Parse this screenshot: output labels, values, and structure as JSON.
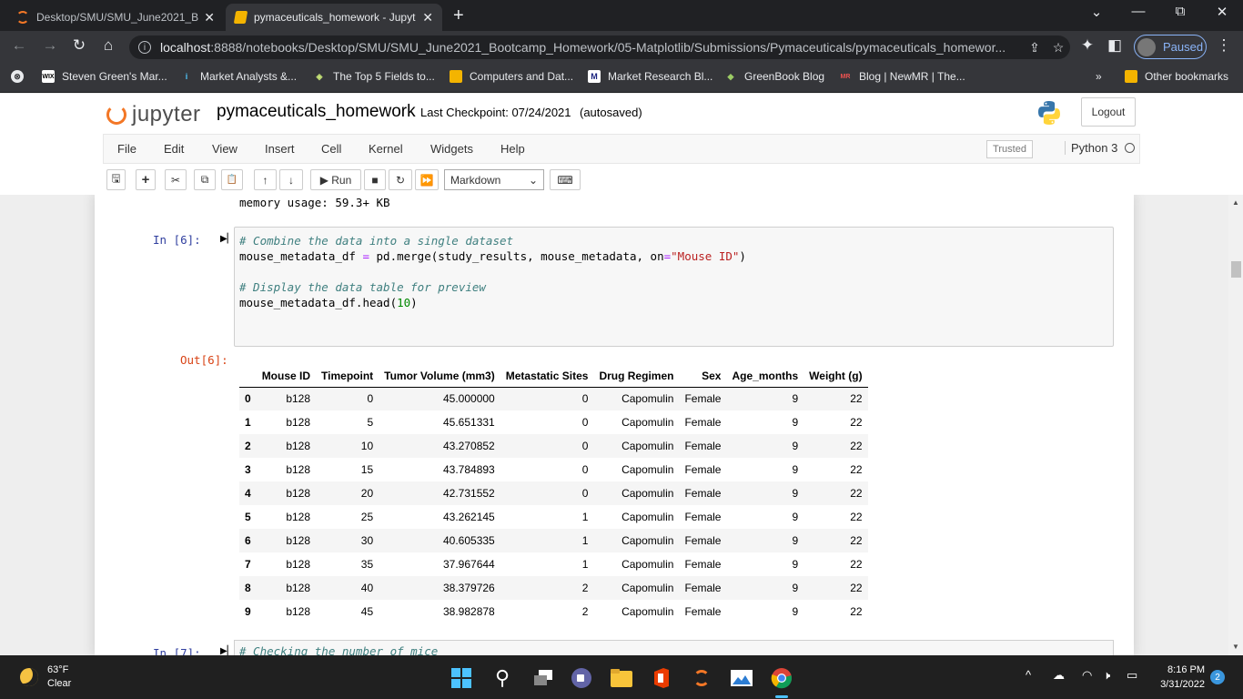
{
  "browser": {
    "tabs": [
      {
        "title": "Desktop/SMU/SMU_June2021_Bo",
        "close": "✕",
        "icon": "jupyter-icon"
      },
      {
        "title": "pymaceuticals_homework - Jupyt",
        "close": "✕",
        "icon": "notebook-icon"
      }
    ],
    "new_tab": "+",
    "window_controls": {
      "dropdown": "⌄",
      "minimize": "—",
      "maximize": "⧉",
      "close": "✕"
    },
    "nav": {
      "back": "←",
      "forward": "→",
      "reload": "↻",
      "home": "⌂"
    },
    "address": {
      "host": "localhost",
      "path": ":8888/notebooks/Desktop/SMU/SMU_June2021_Bootcamp_Homework/05-Matplotlib/Submissions/Pymaceuticals/pymaceuticals_homewor..."
    },
    "profile_label": "Paused",
    "menu_dots": "⋮",
    "bookmarks": [
      {
        "label": "Steven Green's Mar...",
        "icon": "WIX"
      },
      {
        "label": "Market Analysts &...",
        "icon": "i"
      },
      {
        "label": "The Top 5 Fields to...",
        "icon": "◈"
      },
      {
        "label": "Computers and Dat...",
        "icon": ""
      },
      {
        "label": "Market Research Bl...",
        "icon": "M"
      },
      {
        "label": "GreenBook Blog",
        "icon": "◆"
      },
      {
        "label": "Blog | NewMR | The...",
        "icon": "MR"
      }
    ],
    "bookmarks_more": "»",
    "other_bookmarks": "Other bookmarks"
  },
  "jupyter": {
    "logo_text": "jupyter",
    "notebook_name": "pymaceuticals_homework",
    "checkpoint": "Last Checkpoint: 07/24/2021",
    "autosave": "(autosaved)",
    "logout": "Logout",
    "menus": [
      "File",
      "Edit",
      "View",
      "Insert",
      "Cell",
      "Kernel",
      "Widgets",
      "Help"
    ],
    "trusted": "Trusted",
    "kernel": "Python 3",
    "toolbar": {
      "save": "🖫",
      "add": "+",
      "cut": "✂",
      "copy": "⧉",
      "paste": "📋",
      "up": "↑",
      "down": "↓",
      "run": "▶ Run",
      "stop": "■",
      "restart": "↻",
      "ff": "⏩",
      "cell_type": "Markdown",
      "keyboard": "⌨"
    }
  },
  "notebook": {
    "memory_line": "memory usage: 59.3+ KB",
    "in_prompt": "In [6]:",
    "out_prompt": "Out[6]:",
    "code_comment1": "# Combine the data into a single dataset",
    "code_line2_a": "mouse_metadata_df ",
    "code_line2_eq": "=",
    "code_line2_b": " pd.merge(study_results, mouse_metadata, on",
    "code_line2_eq2": "=",
    "code_line2_str": "\"Mouse ID\"",
    "code_line2_end": ")",
    "code_comment2": "# Display the data table for preview",
    "code_line4_a": "mouse_metadata_df.head(",
    "code_line4_num": "10",
    "code_line4_end": ")",
    "next_prompt": "In [7]:",
    "next_code": "# Checking the number of mice",
    "table": {
      "columns": [
        "",
        "Mouse ID",
        "Timepoint",
        "Tumor Volume (mm3)",
        "Metastatic Sites",
        "Drug Regimen",
        "Sex",
        "Age_months",
        "Weight (g)"
      ],
      "rows": [
        [
          "0",
          "b128",
          "0",
          "45.000000",
          "0",
          "Capomulin",
          "Female",
          "9",
          "22"
        ],
        [
          "1",
          "b128",
          "5",
          "45.651331",
          "0",
          "Capomulin",
          "Female",
          "9",
          "22"
        ],
        [
          "2",
          "b128",
          "10",
          "43.270852",
          "0",
          "Capomulin",
          "Female",
          "9",
          "22"
        ],
        [
          "3",
          "b128",
          "15",
          "43.784893",
          "0",
          "Capomulin",
          "Female",
          "9",
          "22"
        ],
        [
          "4",
          "b128",
          "20",
          "42.731552",
          "0",
          "Capomulin",
          "Female",
          "9",
          "22"
        ],
        [
          "5",
          "b128",
          "25",
          "43.262145",
          "1",
          "Capomulin",
          "Female",
          "9",
          "22"
        ],
        [
          "6",
          "b128",
          "30",
          "40.605335",
          "1",
          "Capomulin",
          "Female",
          "9",
          "22"
        ],
        [
          "7",
          "b128",
          "35",
          "37.967644",
          "1",
          "Capomulin",
          "Female",
          "9",
          "22"
        ],
        [
          "8",
          "b128",
          "40",
          "38.379726",
          "2",
          "Capomulin",
          "Female",
          "9",
          "22"
        ],
        [
          "9",
          "b128",
          "45",
          "38.982878",
          "2",
          "Capomulin",
          "Female",
          "9",
          "22"
        ]
      ]
    }
  },
  "taskbar": {
    "temperature": "63°F",
    "condition": "Clear",
    "time": "8:16 PM",
    "date": "3/31/2022",
    "notification_count": "2",
    "tray_chevron": "^"
  }
}
